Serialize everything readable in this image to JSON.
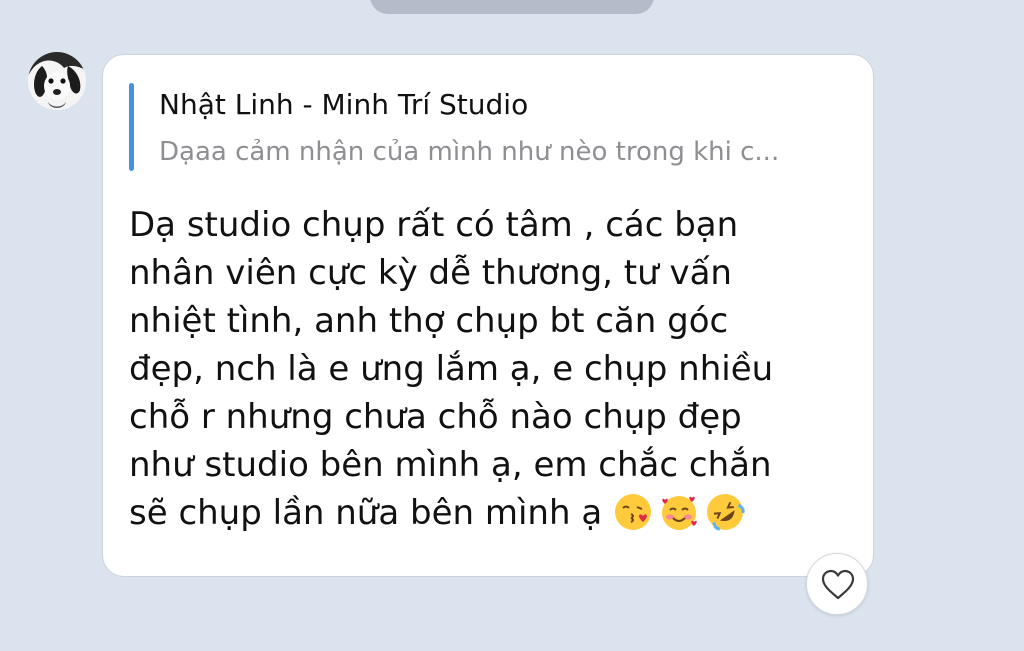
{
  "chat": {
    "quote": {
      "author": "Nhật Linh - Minh Trí Studio",
      "text": "Dạaa cảm nhận của mình như nèo trong khi c..."
    },
    "message": {
      "lines": [
        "Dạ studio chụp rất có tâm , các bạn",
        "nhân viên cực kỳ dễ thương, tư vấn",
        "nhiệt tình, anh thợ chụp bt căn góc",
        "đẹp, nch là e ưng lắm ạ, e chụp nhiều",
        "chỗ r nhưng chưa chỗ nào chụp đẹp",
        "như studio bên mình ạ, em chắc chắn",
        "sẽ chụp lần nữa bên mình ạ"
      ],
      "emojis": [
        "face-blowing-kiss-emoji",
        "smiling-face-with-hearts-emoji",
        "rolling-on-floor-laughing-emoji"
      ]
    },
    "avatar_icon": "dog-avatar",
    "reaction_icon": "heart-outline-icon",
    "colors": {
      "background": "#dbe3ee",
      "bubble": "#ffffff",
      "quote_bar": "#4a90e2",
      "quote_text": "#8e8e93"
    }
  }
}
